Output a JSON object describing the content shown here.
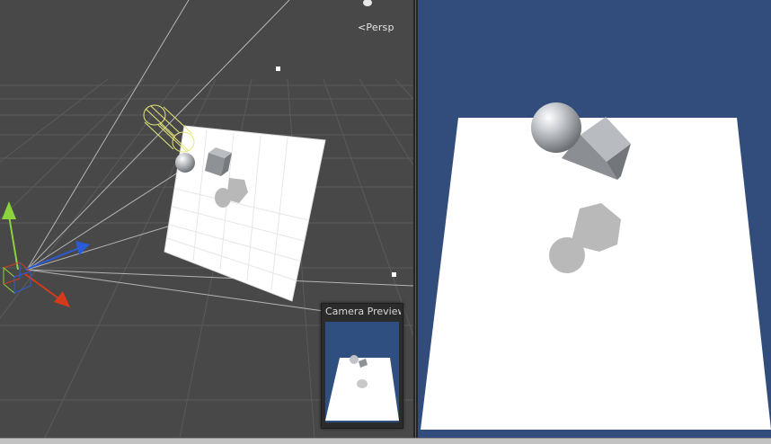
{
  "scene_view": {
    "projection_label": "Persp",
    "colors": {
      "background": "#484848",
      "grid": "#5c5c5c",
      "frustum_lines": "#b8b8b8",
      "plane": "#ffffff",
      "light_gizmo": "#e6e678",
      "gizmo_x": "#d63a1a",
      "gizmo_y": "#8cd23c",
      "gizmo_z": "#2a5bd8"
    },
    "icons": [
      "camera-icon",
      "light-icon",
      "transform-gizmo"
    ]
  },
  "camera_preview": {
    "title": "Camera Preview"
  },
  "game_view": {
    "colors": {
      "background": "#324d7c",
      "plane": "#ffffff",
      "shadow": "#b8b8b8",
      "sphere": "#c9ccd1",
      "cube": "#9ea1a6"
    }
  }
}
